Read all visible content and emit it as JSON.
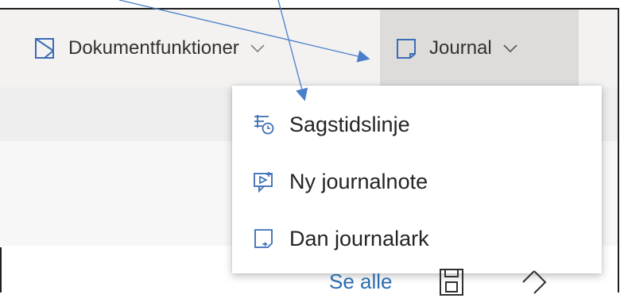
{
  "toolbar": {
    "document_functions": {
      "label": "Dokumentfunktioner",
      "icon": "document-corner-icon",
      "chevron": "chevron-down-icon"
    },
    "journal": {
      "label": "Journal",
      "icon": "journal-icon",
      "chevron": "chevron-down-icon",
      "expanded": true
    }
  },
  "journal_menu": {
    "items": [
      {
        "label": "Sagstidslinje",
        "icon": "timeline-icon"
      },
      {
        "label": "Ny journalnote",
        "icon": "new-note-icon"
      },
      {
        "label": "Dan journalark",
        "icon": "journal-sheet-icon"
      }
    ]
  },
  "content": {
    "see_all_link": "Se alle",
    "icons": [
      "save-icon",
      "tag-icon"
    ]
  },
  "colors": {
    "accent": "#2b6cb0",
    "toolbar_bg": "#f3f2f1",
    "selected_bg": "#dedcdb",
    "arrow": "#4a7fc9"
  }
}
